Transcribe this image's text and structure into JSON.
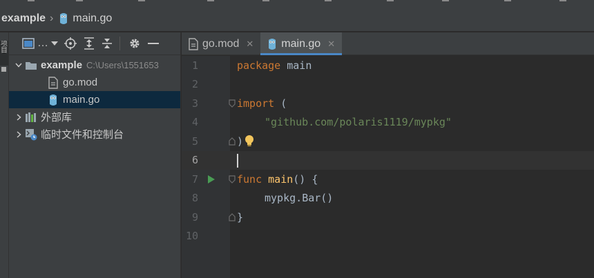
{
  "breadcrumb": {
    "project": "example",
    "file": "main.go"
  },
  "project_panel": {
    "toolbar": {
      "view_label": "…"
    },
    "tree": [
      {
        "label": "example",
        "path": "C:\\Users\\1551653",
        "type": "project-root",
        "expanded": true
      },
      {
        "label": "go.mod",
        "type": "file"
      },
      {
        "label": "main.go",
        "type": "go-file",
        "selected": true
      },
      {
        "label": "外部库",
        "type": "external-libraries",
        "expanded": false
      },
      {
        "label": "临时文件和控制台",
        "type": "scratches",
        "expanded": false
      }
    ]
  },
  "tool_strip": {
    "tab_label": "项目"
  },
  "editor": {
    "tabs": [
      {
        "label": "go.mod",
        "close": "✕",
        "active": false
      },
      {
        "label": "main.go",
        "close": "✕",
        "active": true
      }
    ],
    "line_numbers": [
      "1",
      "2",
      "3",
      "4",
      "5",
      "6",
      "7",
      "8",
      "9",
      "10"
    ],
    "code": {
      "l1_kw": "package",
      "l1_name": " main",
      "l3_kw": "import",
      "l3_rest": " (",
      "l4_str": "\"github.com/polaris1119/mypkg\"",
      "l5_text": ")",
      "l7_kw": "func",
      "l7_name": "main",
      "l7_rest": "() {",
      "l8_pkg": "mypkg",
      "l8_dot": ".",
      "l8_call": "Bar",
      "l8_rest": "()",
      "l9_text": "}"
    },
    "current_line": 6
  },
  "colors": {
    "keyword": "#cc7832",
    "function": "#ffc66d",
    "string": "#6a8759",
    "selection": "#0d293e",
    "tab_underline": "#4a88c7"
  }
}
